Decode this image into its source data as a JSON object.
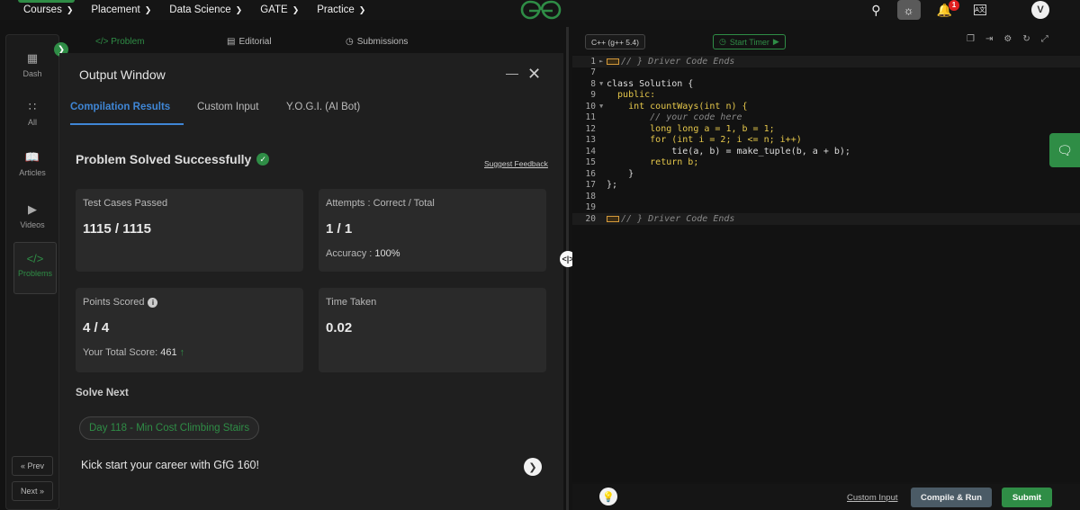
{
  "topnav": {
    "items": [
      {
        "label": "Courses"
      },
      {
        "label": "Placement"
      },
      {
        "label": "Data Science"
      },
      {
        "label": "GATE"
      },
      {
        "label": "Practice"
      }
    ],
    "notification_count": "1",
    "avatar_letter": "V",
    "lang_icon_text": "A文"
  },
  "sidebar": {
    "items": [
      {
        "label": "Dash",
        "icon": "dashboard-icon"
      },
      {
        "label": "All",
        "icon": "grid-icon"
      },
      {
        "label": "Articles",
        "icon": "book-icon"
      },
      {
        "label": "Videos",
        "icon": "video-icon"
      },
      {
        "label": "Problems",
        "icon": "code-icon"
      }
    ],
    "prev_label": "« Prev",
    "next_label": "Next »"
  },
  "problem_tabs": {
    "problem": "</> Problem",
    "editorial": "Editorial",
    "submissions": "Submissions"
  },
  "output_window": {
    "title": "Output Window",
    "tabs": [
      "Compilation Results",
      "Custom Input",
      "Y.O.G.I. (AI Bot)"
    ],
    "status": "Problem Solved Successfully",
    "feedback_link": "Suggest Feedback",
    "cards": {
      "test_cases": {
        "label": "Test Cases Passed",
        "value": "1115 / 1115"
      },
      "attempts": {
        "label": "Attempts : Correct / Total",
        "value": "1 / 1",
        "accuracy_label": "Accuracy :",
        "accuracy_value": "100%"
      },
      "points": {
        "label": "Points Scored",
        "value": "4 / 4",
        "total_label": "Your Total Score:",
        "total_value": "461"
      },
      "time": {
        "label": "Time Taken",
        "value": "0.02"
      }
    },
    "solve_next_label": "Solve Next",
    "solve_next_chip": "Day 118 - Min Cost Climbing Stairs",
    "kickstart": "Kick start your career with GfG 160!"
  },
  "editor": {
    "language": "C++ (g++ 5.4)",
    "timer_label": "Start Timer",
    "code_lines": [
      {
        "n": "1",
        "text": "// } Driver Code Ends"
      },
      {
        "n": "7",
        "text": ""
      },
      {
        "n": "8",
        "text": "class Solution {"
      },
      {
        "n": "9",
        "text": "  public:"
      },
      {
        "n": "10",
        "text": "    int countWays(int n) {"
      },
      {
        "n": "11",
        "text": "        // your code here"
      },
      {
        "n": "12",
        "text": "        long long a = 1, b = 1;"
      },
      {
        "n": "13",
        "text": "        for (int i = 2; i <= n; i++)"
      },
      {
        "n": "14",
        "text": "            tie(a, b) = make_tuple(b, a + b);"
      },
      {
        "n": "15",
        "text": "        return b;"
      },
      {
        "n": "16",
        "text": "    }"
      },
      {
        "n": "17",
        "text": "};"
      },
      {
        "n": "18",
        "text": ""
      },
      {
        "n": "19",
        "text": ""
      },
      {
        "n": "20",
        "text": "// } Driver Code Ends"
      }
    ],
    "custom_input_label": "Custom Input",
    "compile_label": "Compile & Run",
    "submit_label": "Submit"
  },
  "colors": {
    "brand_green": "#2f8d46",
    "tab_blue": "#3f86d5",
    "keyword": "#e6c84b"
  }
}
